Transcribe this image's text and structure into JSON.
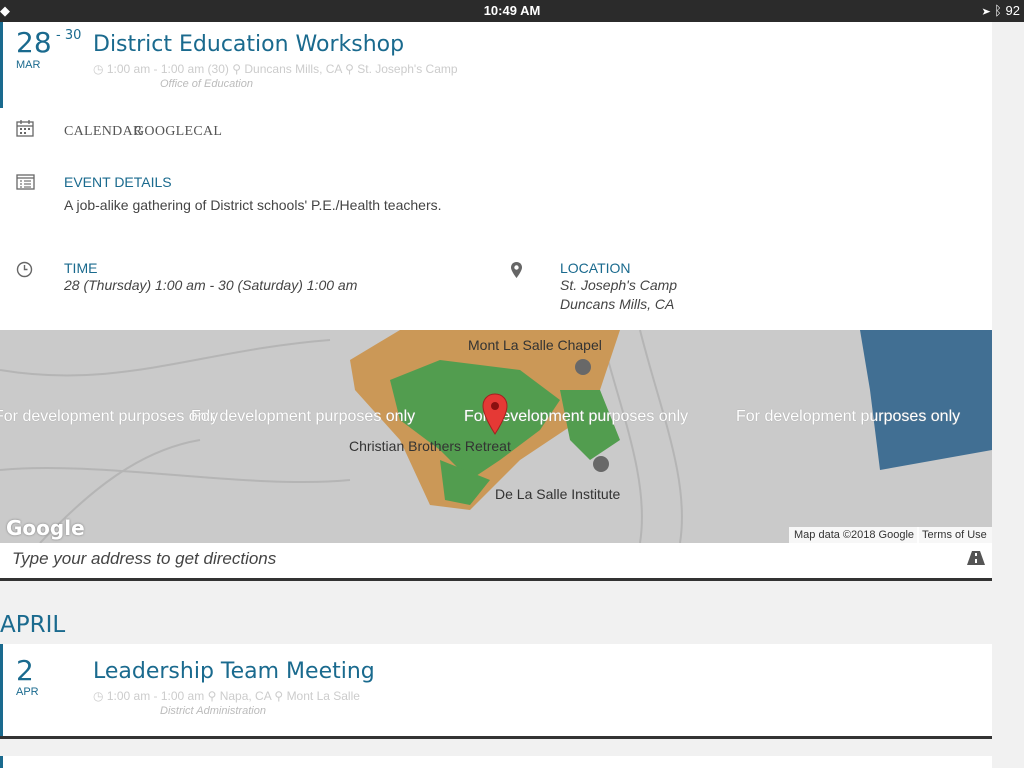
{
  "status": {
    "time": "10:49 AM",
    "battery": "92",
    "left_glyph": "◆"
  },
  "event1": {
    "day": "28",
    "day_end": "- 30",
    "month": "MAR",
    "title": "District Education Workshop",
    "meta_time": "1:00 am - 1:00 am (30)",
    "meta_city": "Duncans Mills, CA",
    "meta_place": "St. Joseph's Camp",
    "org": "Office of Education",
    "calendar_label": "CALENDAR",
    "googlecal_label": "GOOGLECAL",
    "details_label": "EVENT DETAILS",
    "details_text": "A job-alike gathering of District schools' P.E./Health teachers.",
    "time_label": "TIME",
    "time_text": "28 (Thursday) 1:00 am - 30 (Saturday) 1:00 am",
    "location_label": "LOCATION",
    "location_line1": "St. Joseph's Camp",
    "location_line2": "Duncans Mills, CA"
  },
  "map": {
    "watermark": "For development purposes only",
    "label_chapel": "Mont La Salle Chapel",
    "label_retreat": "Christian Brothers Retreat",
    "label_institute": "De La Salle Institute",
    "attribution": "Map data ©2018 Google",
    "terms": "Terms of Use",
    "logo": "Google"
  },
  "directions": {
    "placeholder": "Type your address to get directions"
  },
  "section_month": "APRIL",
  "event2": {
    "day": "2",
    "month": "APR",
    "title": "Leadership Team Meeting",
    "meta_time": "1:00 am - 1:00 am",
    "meta_city": "Napa, CA",
    "meta_place": "Mont La Salle",
    "org": "District Administration"
  },
  "colors": {
    "accent": "#1a6a8e",
    "pin": "#e53935",
    "water": "#4a7fa8"
  },
  "icons": {
    "calendar": "calendar-icon",
    "details": "list-icon",
    "time": "clock-icon",
    "location": "map-pin-icon",
    "directions": "road-icon"
  }
}
